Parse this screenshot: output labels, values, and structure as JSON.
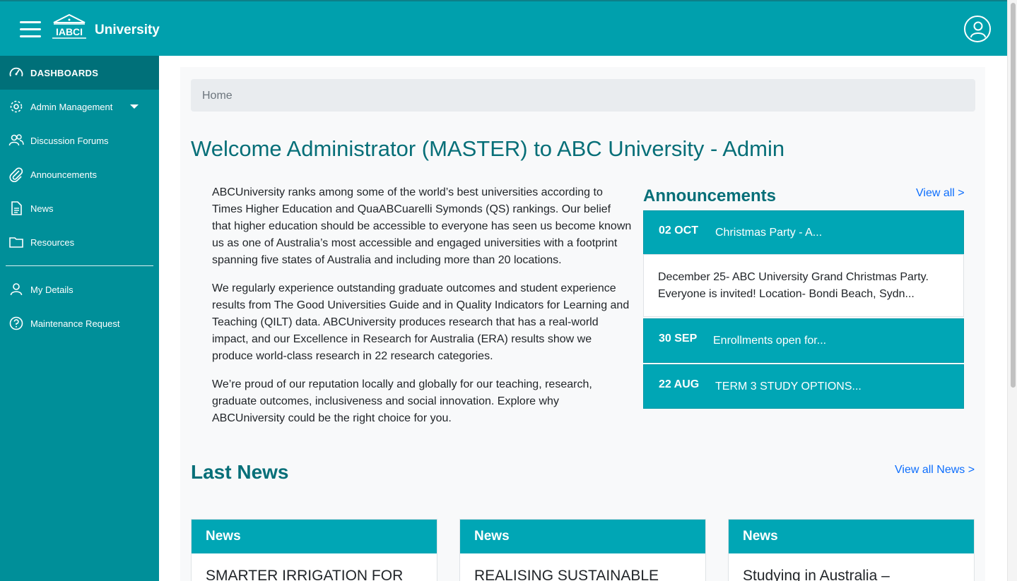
{
  "header": {
    "logo_text": "IABCI",
    "brand": "University",
    "menu_icon": "hamburger-icon",
    "user_icon": "user-circle-icon"
  },
  "sidebar": {
    "items": [
      {
        "label": "DASHBOARDS",
        "icon": "speedometer-icon"
      },
      {
        "label": "Admin Management",
        "icon": "gear-icon"
      },
      {
        "label": "Discussion Forums",
        "icon": "people-icon"
      },
      {
        "label": "Announcements",
        "icon": "paperclip-icon"
      },
      {
        "label": "News",
        "icon": "document-icon"
      },
      {
        "label": "Resources",
        "icon": "folder-icon"
      },
      {
        "label": "My Details",
        "icon": "person-icon"
      },
      {
        "label": "Maintenance Request",
        "icon": "question-circle-icon"
      }
    ]
  },
  "breadcrumb": "Home",
  "page_title": "Welcome Administrator (MASTER) to ABC University - Admin",
  "intro": [
    "ABCUniversity ranks among some of the world’s best universities according to Times Higher Education and QuaABCuarelli Symonds (QS) rankings. Our belief that higher education should be accessible to everyone has seen us become known us as one of Australia’s most accessible and engaged universities with a footprint spanning five states of Australia and including more than 20 locations.",
    "We regularly experience outstanding graduate outcomes and student experience results from The Good Universities Guide and in Quality Indicators for Learning and Teaching (QILT) data. ABCUniversity produces research that has a real-world impact, and our Excellence in Research for Australia (ERA) results show we produce world-class research in 22 research categories.",
    "We’re proud of our reputation locally and globally for our teaching, research, graduate outcomes, inclusiveness and social innovation. Explore why ABCUniversity could be the right choice for you."
  ],
  "announcements": {
    "title": "Announcements",
    "view_all": "View all >",
    "items": [
      {
        "date": "02 OCT",
        "title": "Christmas Party - A...",
        "body": "December 25- ABC University Grand Christmas Party. Everyone is invited! Location- Bondi Beach, Sydn..."
      },
      {
        "date": "30 SEP",
        "title": "Enrollments open for..."
      },
      {
        "date": "22 AUG",
        "title": "TERM 3 STUDY OPTIONS..."
      }
    ]
  },
  "news": {
    "title": "Last News",
    "view_all": "View all News >",
    "cards": [
      {
        "label": "News",
        "title": "SMARTER IRRIGATION FOR"
      },
      {
        "label": "News",
        "title": "REALISING SUSTAINABLE"
      },
      {
        "label": "News",
        "title": "Studying in Australia –"
      }
    ]
  },
  "colors": {
    "header": "#00a0ad",
    "sidebar": "#008f99",
    "sidebar_active": "#007079",
    "card_accent": "#00a6b5",
    "title_text": "#076f78",
    "link": "#0d6efd"
  }
}
